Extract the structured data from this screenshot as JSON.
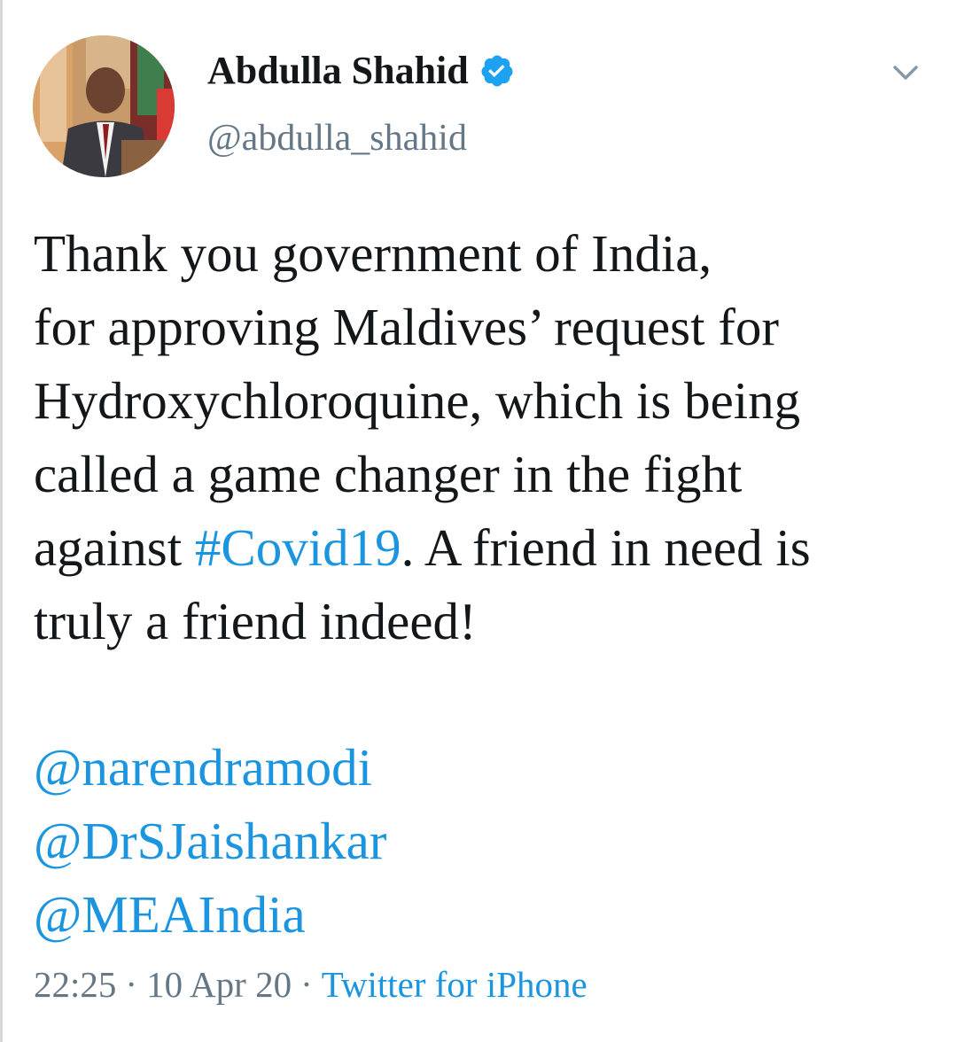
{
  "user": {
    "display_name": "Abdulla Shahid",
    "handle": "@abdulla_shahid",
    "verified": true
  },
  "tweet": {
    "lines": [
      "Thank you government of India,",
      "for approving Maldives’ request for",
      "Hydroxychloroquine, which is being",
      "called a game changer in the fight"
    ],
    "line5_before": "against ",
    "hashtag": "#Covid19",
    "line5_after": ". A friend in need is",
    "line6": "truly a friend indeed!",
    "mentions": [
      "@narendramodi",
      "@DrSJaishankar",
      "@MEAIndia"
    ]
  },
  "meta": {
    "time": "22:25",
    "separator": "·",
    "date": "10 Apr 20",
    "source": "Twitter for iPhone"
  },
  "colors": {
    "link": "#1b95e0",
    "muted": "#657786",
    "text": "#14171a"
  },
  "icons": {
    "verified": "verified-badge-icon",
    "caret": "chevron-down-icon"
  }
}
